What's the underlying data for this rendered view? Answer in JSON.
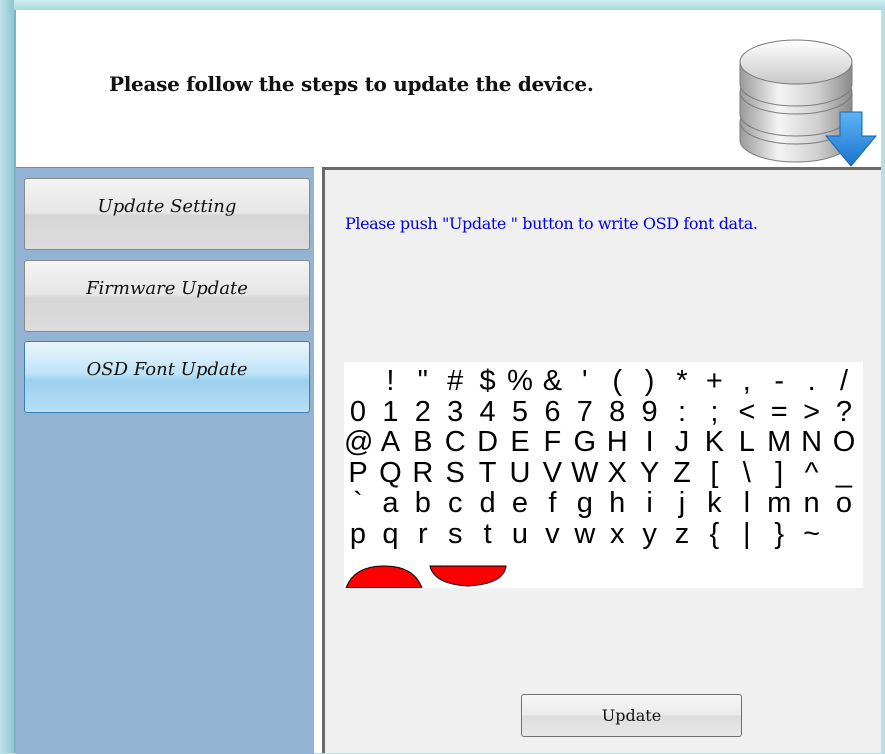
{
  "header": {
    "title": "Please follow the steps to update the device.",
    "icon": "database-download-icon"
  },
  "sidebar": {
    "items": [
      {
        "label": "Update Setting",
        "active": false
      },
      {
        "label": "Firmware Update",
        "active": false
      },
      {
        "label": "OSD Font Update",
        "active": true
      }
    ]
  },
  "main": {
    "instruction": "Please push \"Update \" button to write OSD font data.",
    "instruction_color": "#0000e0",
    "font_preview_rows": [
      [
        " ",
        "!",
        "\"",
        "#",
        "$",
        "%",
        "&",
        "'",
        "(",
        ")",
        "*",
        "+",
        ",",
        "-",
        ".",
        "/"
      ],
      [
        "0",
        "1",
        "2",
        "3",
        "4",
        "5",
        "6",
        "7",
        "8",
        "9",
        ":",
        ";",
        "<",
        "=",
        ">",
        "?"
      ],
      [
        "@",
        "A",
        "B",
        "C",
        "D",
        "E",
        "F",
        "G",
        "H",
        "I",
        "J",
        "K",
        "L",
        "M",
        "N",
        "O"
      ],
      [
        "P",
        "Q",
        "R",
        "S",
        "T",
        "U",
        "V",
        "W",
        "X",
        "Y",
        "Z",
        "[",
        "\\",
        "]",
        "^",
        "_"
      ],
      [
        "`",
        "a",
        "b",
        "c",
        "d",
        "e",
        "f",
        "g",
        "h",
        "i",
        "j",
        "k",
        "l",
        "m",
        "n",
        "o"
      ],
      [
        "p",
        "q",
        "r",
        "s",
        "t",
        "u",
        "v",
        "w",
        "x",
        "y",
        "z",
        "{",
        "|",
        "}",
        "~",
        ""
      ]
    ],
    "extra_glyph_color": "#ff0000",
    "update_label": "Update"
  }
}
